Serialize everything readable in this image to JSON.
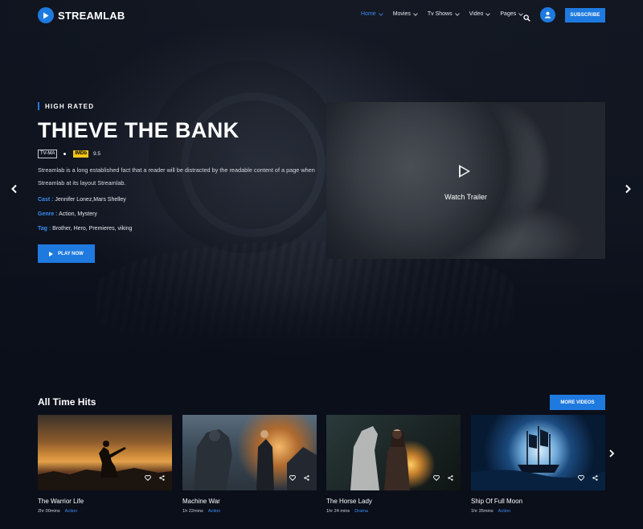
{
  "brand": {
    "name": "STREAMLAB",
    "accent": "#1f7ae0",
    "link_color": "#3b8df2"
  },
  "nav": {
    "items": [
      {
        "label": "Home",
        "active": true
      },
      {
        "label": "Movies",
        "active": false
      },
      {
        "label": "Tv Shows",
        "active": false
      },
      {
        "label": "Video",
        "active": false
      },
      {
        "label": "Pages",
        "active": false
      }
    ],
    "subscribe_label": "SUBSCRIBE"
  },
  "hero": {
    "badge": "HIGH RATED",
    "title": "THIEVE THE BANK",
    "rating": "TV-MA",
    "imdb_label": "IMDb",
    "imdb_score": "9.5",
    "description": "Streamlab is a long established fact that a reader will be distracted by the readable content of a page when Streamlab at its layout Streamlab.",
    "cast_label": "Cast :",
    "cast": "Jennifer Lonez,Mars Shelley",
    "genre_label": "Genre :",
    "genre": "Action, Mystery",
    "tag_label": "Tag :",
    "tags": "Brother, Hero, Premieres, viking",
    "play_label": "PLAY NOW",
    "trailer_label": "Watch Trailer"
  },
  "section": {
    "title": "All Time Hits",
    "more_label": "MORE VIDEOS",
    "cards": [
      {
        "title": "The Warrior Life",
        "duration": "2hr 00mins",
        "genre": "Action"
      },
      {
        "title": "Machine War",
        "duration": "1h 22mins",
        "genre": "Action"
      },
      {
        "title": "The Horse Lady",
        "duration": "1hr 24 mins",
        "genre": "Drama"
      },
      {
        "title": "Ship Of Full Moon",
        "duration": "1hr 35mins",
        "genre": "Action"
      }
    ]
  }
}
